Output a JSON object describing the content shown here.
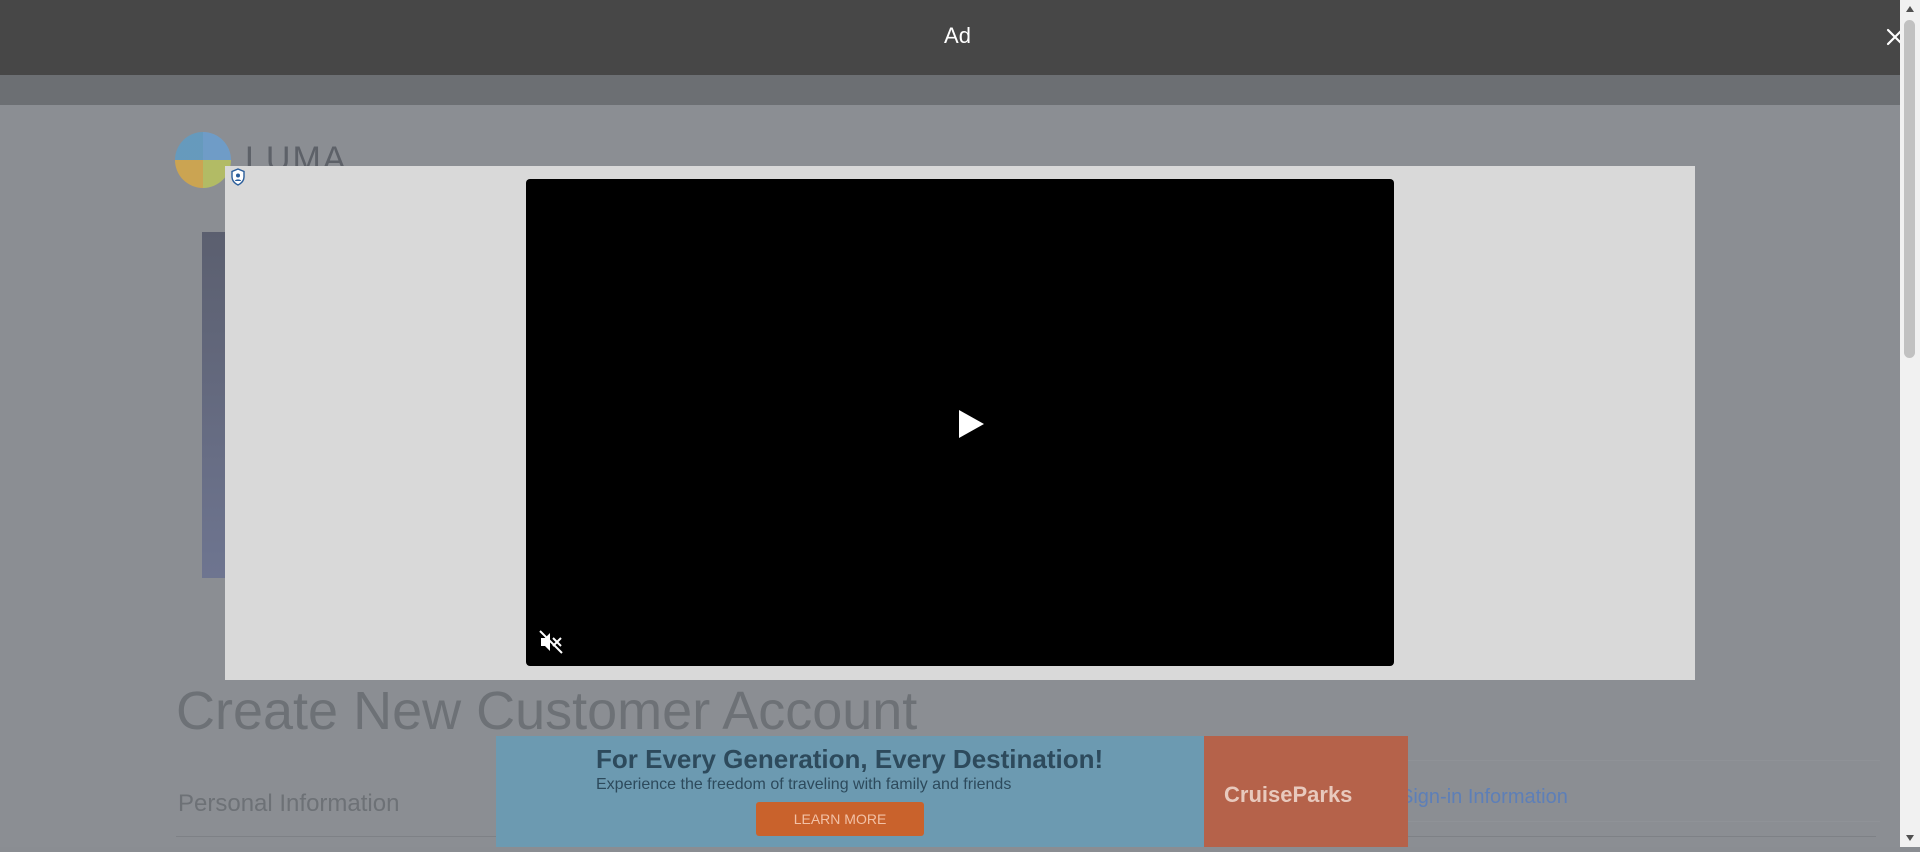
{
  "ad_overlay": {
    "title": "Ad",
    "close_label": "✕"
  },
  "background_page": {
    "logo_text": "LUMA",
    "heading": "Create New Customer Account",
    "section_title": "Personal Information",
    "right_link": "Sign-in Information"
  },
  "banner_ad": {
    "headline": "For Every Generation, Every Destination!",
    "subline": "Experience the freedom of traveling with family and friends",
    "cta_label": "LEARN MORE",
    "brand_name": "CruiseParks"
  },
  "video_player": {
    "play_icon": "play-icon",
    "mute_icon": "muted-speaker-icon",
    "privacy_icon": "privacy-shield-icon"
  },
  "colors": {
    "header_bg": "#474747",
    "panel_bg": "#d9d9d9",
    "video_bg": "#000000",
    "dim_page": "#8b8e93"
  }
}
